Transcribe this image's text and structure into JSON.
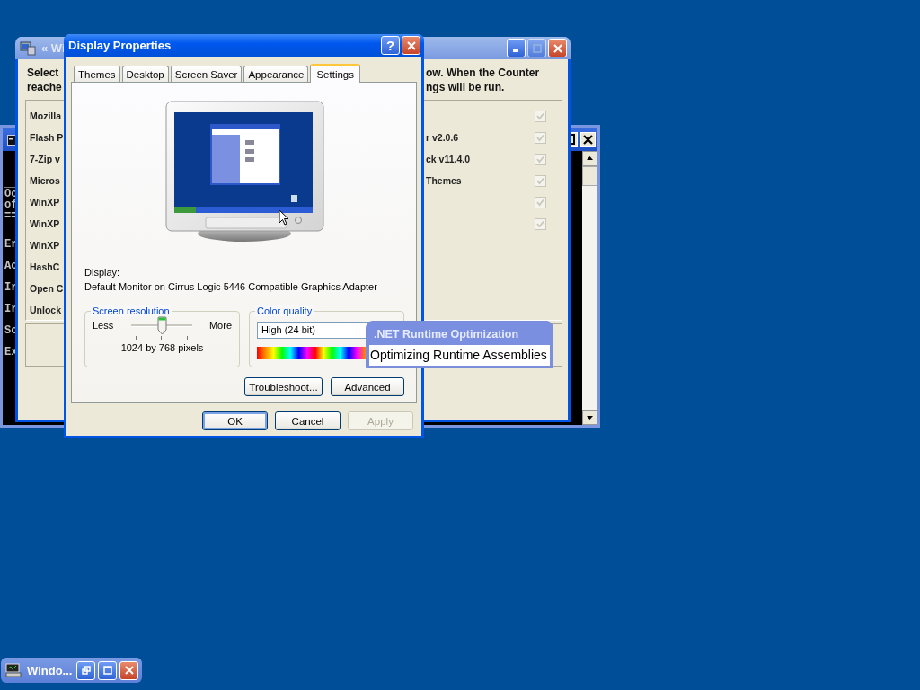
{
  "console_window": {
    "lines": [
      "__",
      "Oc",
      "of",
      "==",
      "Er",
      "Ac",
      "Ir",
      "Ir",
      "Sc",
      "Ex"
    ]
  },
  "install_window": {
    "title": "« Wi",
    "intro_left": [
      "Select",
      "reache"
    ],
    "intro_right": [
      "ow. When the Counter",
      "ngs will be run."
    ],
    "items": [
      {
        "left": "Mozilla",
        "checked": true,
        "disabled": true
      },
      {
        "left": "Flash P",
        "right": "r v2.0.6",
        "checked": true,
        "disabled": true
      },
      {
        "left": "7-Zip v",
        "right": "ck v11.4.0",
        "checked": true,
        "disabled": true
      },
      {
        "left": "Micros",
        "right": "Themes",
        "checked": true,
        "disabled": true
      },
      {
        "left": "WinXP",
        "checked": true,
        "disabled": true
      },
      {
        "left": "WinXP",
        "checked": true,
        "disabled": true
      },
      {
        "left": "WinXP"
      },
      {
        "left": "HashC"
      },
      {
        "left": "Open C"
      },
      {
        "left": "Unlock"
      }
    ]
  },
  "dialog": {
    "title": "Display Properties",
    "help": "?",
    "tabs": [
      {
        "label": "Themes",
        "selected": false
      },
      {
        "label": "Desktop",
        "selected": false
      },
      {
        "label": "Screen Saver",
        "selected": false
      },
      {
        "label": "Appearance",
        "selected": false
      },
      {
        "label": "Settings",
        "selected": true
      }
    ],
    "display_label": "Display:",
    "display_value": "Default Monitor on Cirrus Logic 5446 Compatible Graphics Adapter",
    "resolution": {
      "legend": "Screen resolution",
      "min_label": "Less",
      "max_label": "More",
      "level": 0.5,
      "reading": "1024 by 768 pixels"
    },
    "color_quality": {
      "legend": "Color quality",
      "value": "High (24 bit)"
    },
    "buttons": [
      {
        "label": "Troubleshoot..."
      },
      {
        "label": "Advanced"
      }
    ],
    "footer_buttons": [
      {
        "label": "OK",
        "default": true,
        "disabled": false
      },
      {
        "label": "Cancel",
        "default": false,
        "disabled": false
      },
      {
        "label": "Apply",
        "default": false,
        "disabled": true
      }
    ]
  },
  "balloon": {
    "title": ".NET Runtime Optimization",
    "message": "Optimizing Runtime Assemblies"
  },
  "taskbar_item": {
    "label": "Windo..."
  }
}
